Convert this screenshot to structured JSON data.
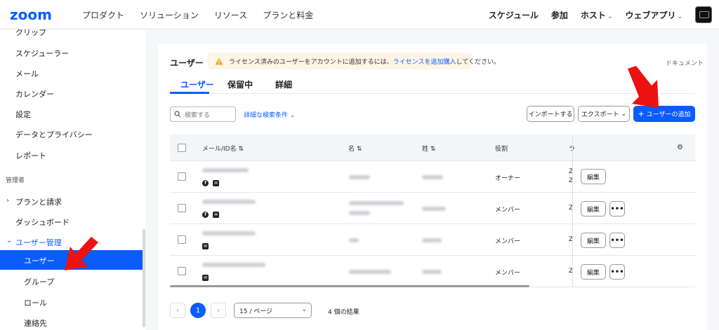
{
  "brand": {
    "logo": "zoom",
    "accent": "#0b5cff"
  },
  "topnav": {
    "items": [
      "プロダクト",
      "ソリューション",
      "リソース",
      "プランと料金"
    ],
    "right": {
      "schedule": "スケジュール",
      "join": "参加",
      "host": "ホスト",
      "webapp": "ウェブアプリ"
    }
  },
  "sidebar": {
    "items_top": [
      "クリップ",
      "スケジューラー",
      "メール",
      "カレンダー",
      "設定",
      "データとプライバシー",
      "レポート"
    ],
    "admin_section": "管理者",
    "plans": "プランと請求",
    "dashboard": "ダッシュボード",
    "user_mgmt": "ユーザー管理",
    "sub": {
      "users": "ユーザー",
      "groups": "グループ",
      "roles": "ロール",
      "contacts": "連絡先"
    }
  },
  "main": {
    "title": "ユーザー",
    "banner": {
      "text_before": "ライセンス済みのユーザーをアカウントに追加するには、",
      "link": "ライセンスを追加購入",
      "text_after": "してください。"
    },
    "doc_link": "ドキュメント",
    "tabs": [
      "ユーザー",
      "保留中",
      "詳細"
    ],
    "search_placeholder": "検索する",
    "advanced_search": "詳細な検索条件",
    "import_button": "インポートする",
    "export_button": "エクスポート",
    "add_user_button": "ユーザーの追加"
  },
  "table": {
    "headers": {
      "email": "メール/ID名",
      "first": "名",
      "last": "姓",
      "role": "役割",
      "more": "ラ"
    },
    "rows": [
      {
        "role": "オーナー",
        "extra": [
          "Z",
          "Z"
        ],
        "icons": [
          "facebook",
          "mail"
        ],
        "has_more": false
      },
      {
        "role": "メンバー",
        "extra": [
          "Z"
        ],
        "icons": [
          "facebook",
          "mail"
        ],
        "has_more": true
      },
      {
        "role": "メンバー",
        "extra": [
          "Z"
        ],
        "icons": [
          "mail"
        ],
        "has_more": true
      },
      {
        "role": "メンバー",
        "extra": [
          "Z"
        ],
        "icons": [
          "mail"
        ],
        "has_more": true
      }
    ],
    "edit_label": "編集",
    "more_label": "•••"
  },
  "pagination": {
    "current": "1",
    "per_page": "15 / ページ",
    "results": "4 個の結果"
  }
}
